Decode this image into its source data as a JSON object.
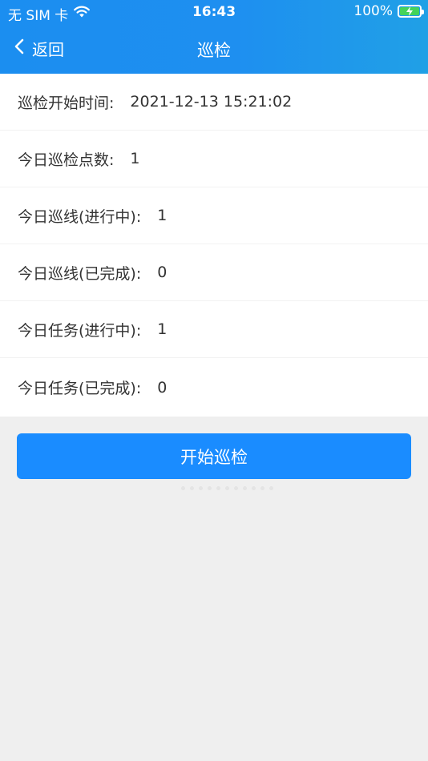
{
  "status_bar": {
    "carrier": "无 SIM 卡",
    "time": "16:43",
    "battery": "100%",
    "battery_color": "#44d35a"
  },
  "nav": {
    "back_label": "返回",
    "title": "巡检"
  },
  "rows": [
    {
      "label": "巡检开始时间:",
      "value": "2021-12-13 15:21:02"
    },
    {
      "label": "今日巡检点数:",
      "value": "1"
    },
    {
      "label": "今日巡线(进行中):",
      "value": "1"
    },
    {
      "label": "今日巡线(已完成):",
      "value": "0"
    },
    {
      "label": "今日任务(进行中):",
      "value": "1"
    },
    {
      "label": "今日任务(已完成):",
      "value": "0"
    }
  ],
  "action": {
    "start_label": "开始巡检",
    "color": "#1a8cff"
  },
  "theme": {
    "header_color": "#1b8ef0",
    "background": "#efefef"
  }
}
